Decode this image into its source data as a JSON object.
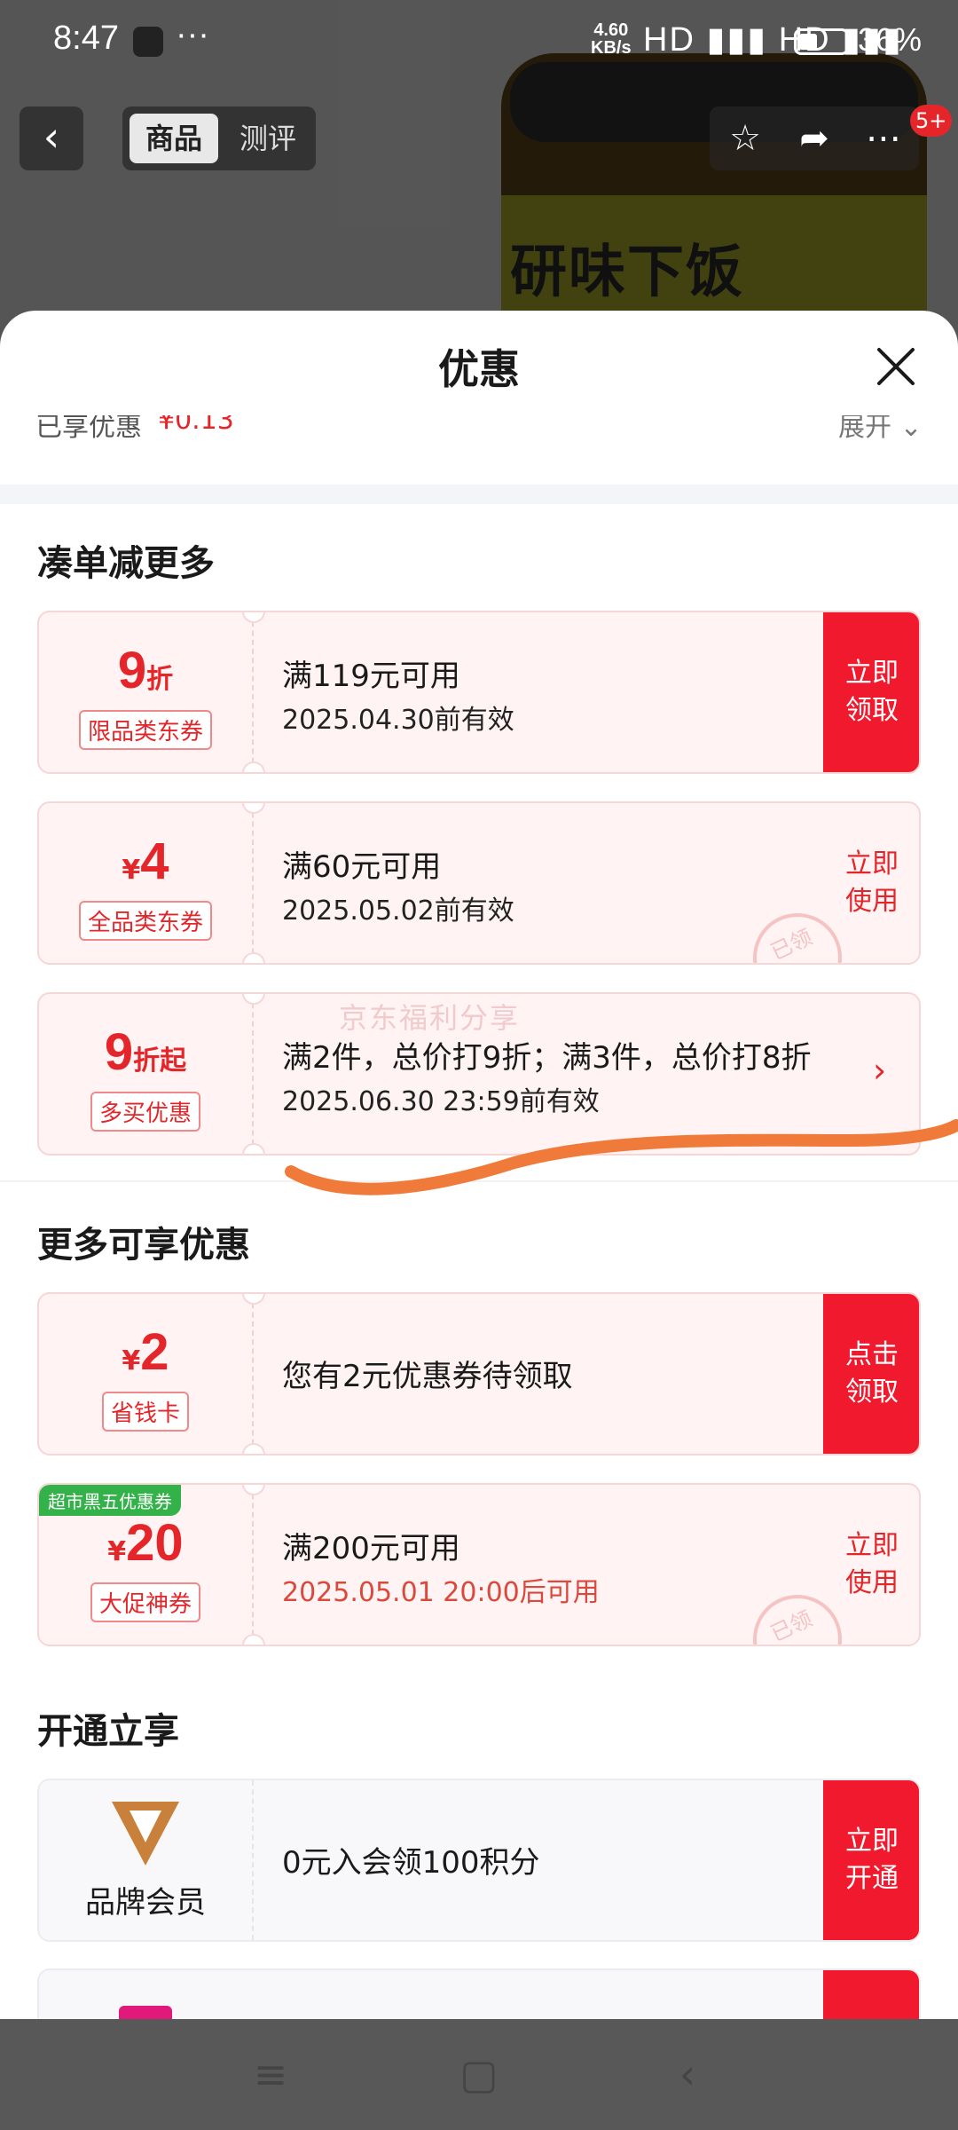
{
  "status_bar": {
    "time": "8:47",
    "dots": "···",
    "network_speed": "4.60\nKB/s",
    "signal": "HD ▮▮▮ HD ▮▮▮",
    "battery_percent": "36%"
  },
  "product_page": {
    "back_label": "‹",
    "tabs": [
      "商品",
      "测评"
    ],
    "label_text": "研味下饭",
    "notification_badge": "5+"
  },
  "sheet": {
    "title": "优惠",
    "enjoyed_label": "已享优惠",
    "enjoyed_value": "¥0.13",
    "expand_label": "展开"
  },
  "sections": [
    {
      "heading": "凑单减更多",
      "coupons": [
        {
          "amount": "9",
          "unit": "折",
          "currency": "",
          "tag": "限品类东券",
          "condition": "满119元可用",
          "validity": "2025.04.30前有效",
          "action": "立即领取",
          "action_style": "solid"
        },
        {
          "amount": "4",
          "unit": "",
          "currency": "¥",
          "tag": "全品类东券",
          "condition": "满60元可用",
          "validity": "2025.05.02前有效",
          "action": "立即使用",
          "action_style": "light",
          "stamp": "已领"
        },
        {
          "amount": "9",
          "unit": "折起",
          "currency": "",
          "tag": "多买优惠",
          "condition": "满2件，总价打9折；满3件，总价打8折",
          "validity": "2025.06.30 23:59前有效",
          "action": "›",
          "action_style": "arrow"
        }
      ]
    },
    {
      "heading": "更多可享优惠",
      "coupons": [
        {
          "amount": "2",
          "unit": "",
          "currency": "¥",
          "tag": "省钱卡",
          "condition": "您有2元优惠券待领取",
          "validity": "",
          "action": "点击领取",
          "action_style": "solid"
        },
        {
          "amount": "20",
          "unit": "",
          "currency": "¥",
          "tag": "大促神券",
          "corner_badge": "超市黑五优惠券",
          "condition": "满200元可用",
          "validity": "2025.05.01 20:00后可用",
          "action": "立即使用",
          "action_style": "light",
          "stamp": "已领"
        }
      ]
    },
    {
      "heading": "开通立享",
      "coupons": [
        {
          "member_label": "品牌会员",
          "condition": "0元入会领100积分",
          "action": "立即开通",
          "action_style": "solid"
        }
      ]
    }
  ],
  "watermark": "京东福利分享",
  "colors": {
    "accent": "#f0192d",
    "coupon_bg": "#fff3f3",
    "green_badge": "#34b24a",
    "annotation": "#f07a3a"
  },
  "icons": [
    "back-icon",
    "star-icon",
    "share-icon",
    "more-icon",
    "close-icon",
    "chevron-down-icon",
    "chevron-right-icon",
    "brand-member-logo",
    "menu-icon",
    "home-icon",
    "nav-back-icon"
  ]
}
